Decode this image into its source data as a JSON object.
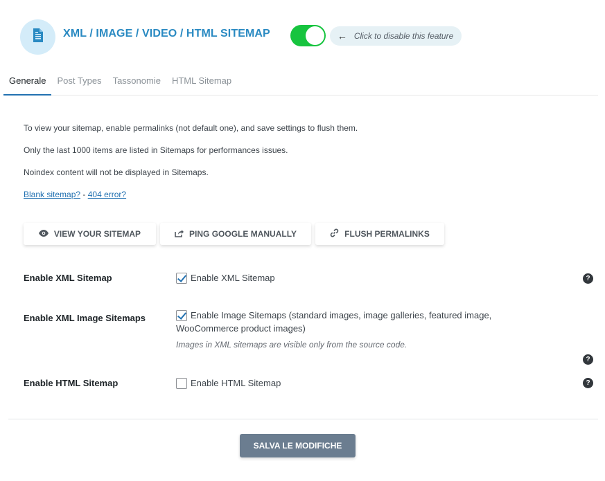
{
  "header": {
    "title": "XML / IMAGE / VIDEO / HTML SITEMAP",
    "toggle_state": "on",
    "hint": "Click to disable this feature",
    "icon": "document-icon",
    "accent_color": "#2a8ac2",
    "toggle_color": "#17c43f"
  },
  "tabs": [
    {
      "label": "Generale",
      "active": true
    },
    {
      "label": "Post Types",
      "active": false
    },
    {
      "label": "Tassonomie",
      "active": false
    },
    {
      "label": "HTML Sitemap",
      "active": false
    }
  ],
  "info": {
    "line1": "To view your sitemap, enable permalinks (not default one), and save settings to flush them.",
    "line2": "Only the last 1000 items are listed in Sitemaps for performances issues.",
    "line3": "Noindex content will not be displayed in Sitemaps.",
    "link_blank": "Blank sitemap?",
    "separator": " - ",
    "link_404": "404 error?"
  },
  "actions": {
    "view": {
      "label": "VIEW YOUR SITEMAP",
      "icon": "eye-icon"
    },
    "ping": {
      "label": "PING GOOGLE MANUALLY",
      "icon": "share-icon"
    },
    "flush": {
      "label": "FLUSH PERMALINKS",
      "icon": "link-icon"
    }
  },
  "settings": {
    "xml": {
      "label": "Enable XML Sitemap",
      "checkbox_label": "Enable XML Sitemap",
      "checked": true
    },
    "image": {
      "label": "Enable XML Image Sitemaps",
      "checkbox_label_1": "Enable Image Sitemaps (standard images, image galleries, featured image,",
      "checkbox_label_2": "WooCommerce product images)",
      "description": "Images in XML sitemaps are visible only from the source code.",
      "checked": true
    },
    "html": {
      "label": "Enable HTML Sitemap",
      "checkbox_label": "Enable HTML Sitemap",
      "checked": false
    }
  },
  "help_glyph": "?",
  "save_label": "SALVA LE MODIFICHE",
  "save_color": "#6b7d90"
}
